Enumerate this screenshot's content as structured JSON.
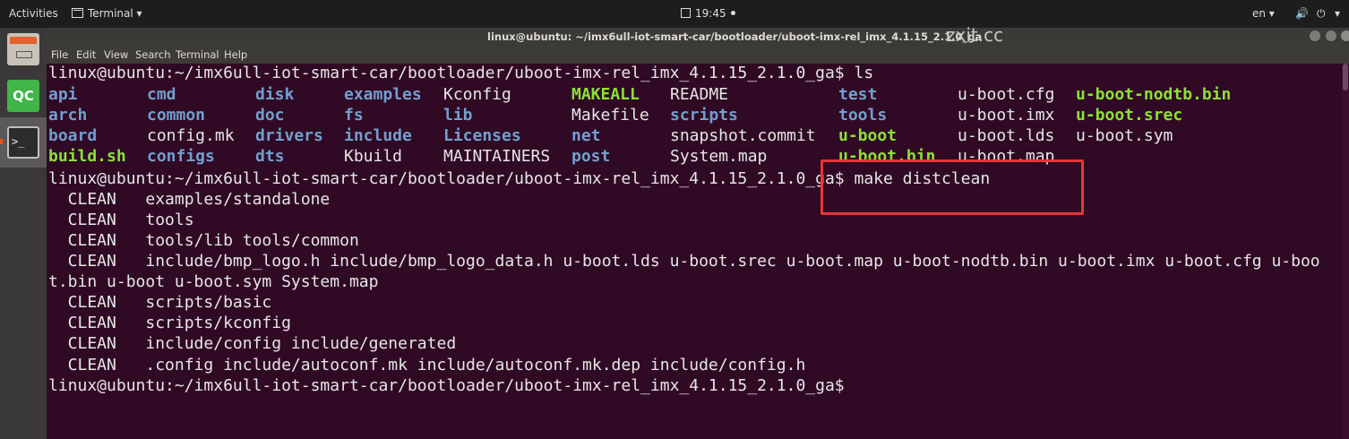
{
  "topbar": {
    "activities": "Activities",
    "app_menu": "Terminal ▾",
    "clock": "19:45",
    "language": "en ▾",
    "volume_icon": "speaker-icon",
    "power_icon": "power-icon",
    "menu_arrow": "▾"
  },
  "dock": {
    "items": [
      {
        "name": "files",
        "icon": "files-icon"
      },
      {
        "name": "qt-creator",
        "icon": "qt-icon",
        "label": "QC"
      },
      {
        "name": "terminal",
        "icon": "terminal-icon",
        "label": ">_"
      }
    ]
  },
  "window": {
    "title": "linux@ubuntu: ~/imx6ull-iot-smart-car/bootloader/uboot-imx-rel_imx_4.1.15_2.1.0_ga",
    "watermark": "zxit.cc"
  },
  "menubar": {
    "items": [
      "File",
      "Edit",
      "View",
      "Search",
      "Terminal",
      "Help"
    ]
  },
  "terminal": {
    "prompt": "linux@ubuntu:~/imx6ull-iot-smart-car/bootloader/uboot-imx-rel_imx_4.1.15_2.1.0_ga$",
    "cmd_ls": " ls",
    "cmd_distclean": " make distclean",
    "listing": [
      [
        {
          "text": "api",
          "type": "dir"
        },
        {
          "text": "cmd",
          "type": "dir"
        },
        {
          "text": "disk",
          "type": "dir"
        },
        {
          "text": "examples",
          "type": "dir"
        },
        {
          "text": "Kconfig",
          "type": "plain"
        },
        {
          "text": "MAKEALL",
          "type": "exe"
        },
        {
          "text": "README",
          "type": "plain"
        },
        {
          "text": "test",
          "type": "dir"
        },
        {
          "text": "u-boot.cfg",
          "type": "plain"
        },
        {
          "text": "u-boot-nodtb.bin",
          "type": "exe"
        }
      ],
      [
        {
          "text": "arch",
          "type": "dir"
        },
        {
          "text": "common",
          "type": "dir"
        },
        {
          "text": "doc",
          "type": "dir"
        },
        {
          "text": "fs",
          "type": "dir"
        },
        {
          "text": "lib",
          "type": "dir"
        },
        {
          "text": "Makefile",
          "type": "plain"
        },
        {
          "text": "scripts",
          "type": "dir"
        },
        {
          "text": "tools",
          "type": "dir"
        },
        {
          "text": "u-boot.imx",
          "type": "plain"
        },
        {
          "text": "u-boot.srec",
          "type": "exe"
        }
      ],
      [
        {
          "text": "board",
          "type": "dir"
        },
        {
          "text": "config.mk",
          "type": "plain"
        },
        {
          "text": "drivers",
          "type": "dir"
        },
        {
          "text": "include",
          "type": "dir"
        },
        {
          "text": "Licenses",
          "type": "dir"
        },
        {
          "text": "net",
          "type": "dir"
        },
        {
          "text": "snapshot.commit",
          "type": "plain"
        },
        {
          "text": "u-boot",
          "type": "exe"
        },
        {
          "text": "u-boot.lds",
          "type": "plain"
        },
        {
          "text": "u-boot.sym",
          "type": "plain"
        }
      ],
      [
        {
          "text": "build.sh",
          "type": "exe"
        },
        {
          "text": "configs",
          "type": "dir"
        },
        {
          "text": "dts",
          "type": "dir"
        },
        {
          "text": "Kbuild",
          "type": "plain"
        },
        {
          "text": "MAINTAINERS",
          "type": "plain"
        },
        {
          "text": "post",
          "type": "dir"
        },
        {
          "text": "System.map",
          "type": "plain"
        },
        {
          "text": "u-boot.bin",
          "type": "exe"
        },
        {
          "text": "u-boot.map",
          "type": "plain"
        },
        {
          "text": "",
          "type": "plain"
        }
      ]
    ],
    "clean_lines": [
      "  CLEAN   examples/standalone",
      "  CLEAN   tools",
      "  CLEAN   tools/lib tools/common",
      "  CLEAN   include/bmp_logo.h include/bmp_logo_data.h u-boot.lds u-boot.srec u-boot.map u-boot-nodtb.bin u-boot.imx u-boot.cfg u-boo",
      "t.bin u-boot u-boot.sym System.map",
      "  CLEAN   scripts/basic",
      "  CLEAN   scripts/kconfig",
      "  CLEAN   include/config include/generated",
      "  CLEAN   .config include/autoconf.mk include/autoconf.mk.dep include/config.h"
    ]
  },
  "colors": {
    "terminal_bg": "#300a24",
    "dir": "#729fcf",
    "exe": "#8ae234",
    "text": "#e6e6e6",
    "highlight": "#e43636"
  }
}
